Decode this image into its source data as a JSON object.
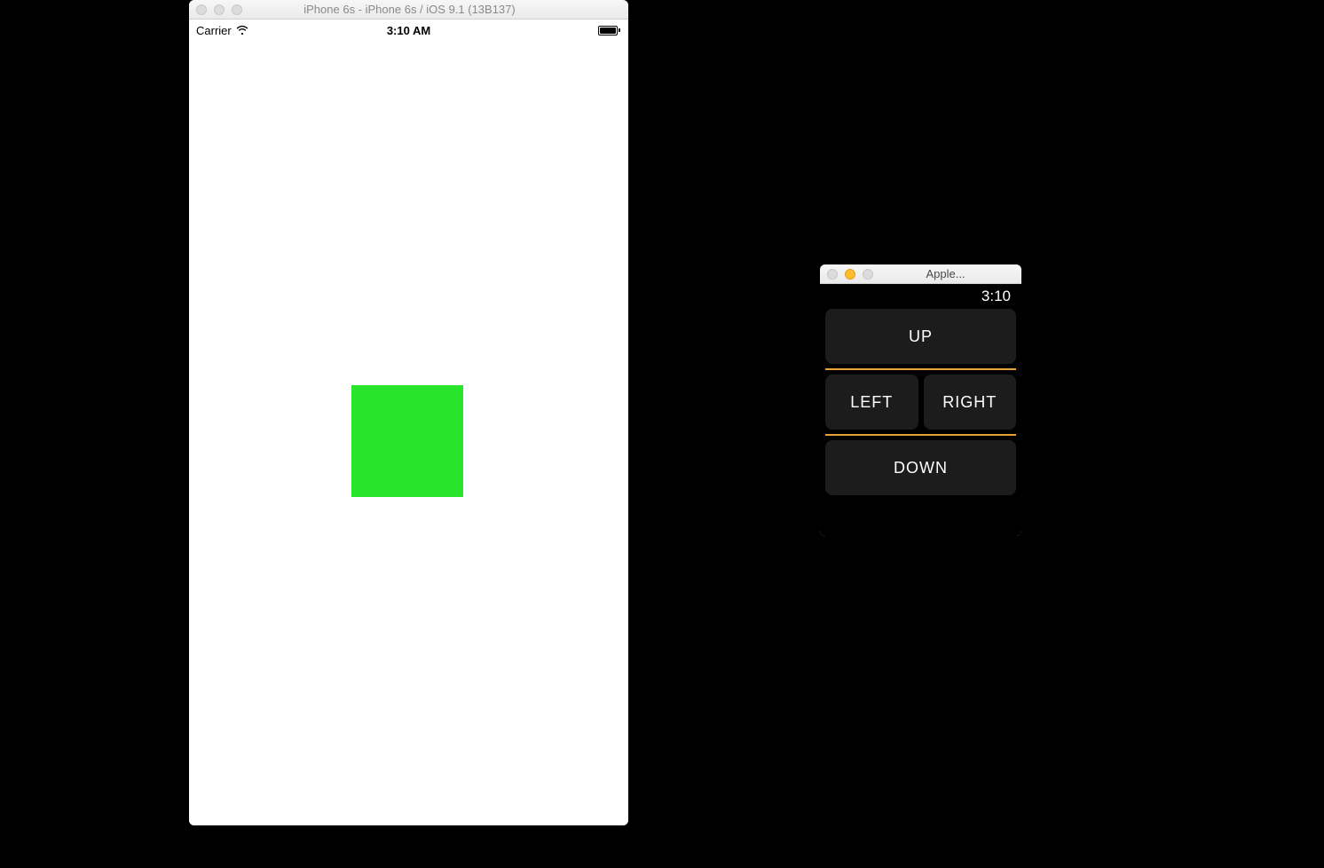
{
  "iphone": {
    "window_title": "iPhone 6s - iPhone 6s / iOS 9.1 (13B137)",
    "statusbar": {
      "carrier": "Carrier",
      "time": "3:10 AM",
      "wifi_icon": "wifi-icon",
      "battery_icon": "battery-full-icon"
    },
    "content": {
      "square_color": "#28e52b"
    }
  },
  "watch": {
    "window_title": "Apple...",
    "statusbar": {
      "time": "3:10"
    },
    "buttons": {
      "up": "UP",
      "left": "LEFT",
      "right": "RIGHT",
      "down": "DOWN"
    },
    "divider_color": "#e8a23a"
  }
}
